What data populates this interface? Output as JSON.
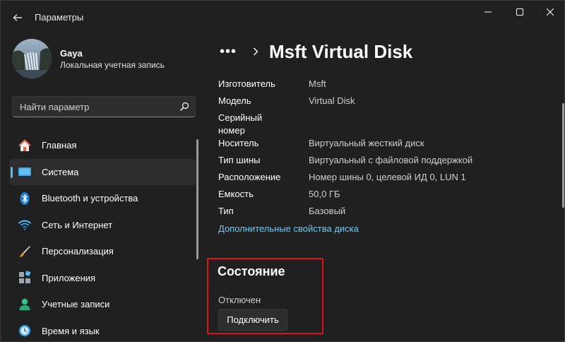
{
  "window": {
    "title": "Параметры"
  },
  "user": {
    "name": "Gaya",
    "account_type": "Локальная учетная запись"
  },
  "search": {
    "placeholder": "Найти параметр"
  },
  "sidebar": {
    "items": [
      {
        "label": "Главная",
        "icon": "home-icon"
      },
      {
        "label": "Система",
        "icon": "system-icon",
        "active": true
      },
      {
        "label": "Bluetooth и устройства",
        "icon": "bluetooth-icon"
      },
      {
        "label": "Сеть и Интернет",
        "icon": "wifi-icon"
      },
      {
        "label": "Персонализация",
        "icon": "brush-icon"
      },
      {
        "label": "Приложения",
        "icon": "apps-icon"
      },
      {
        "label": "Учетные записи",
        "icon": "accounts-icon"
      },
      {
        "label": "Время и язык",
        "icon": "time-language-icon"
      }
    ]
  },
  "breadcrumb": {
    "more": "•••",
    "title": "Msft Virtual Disk"
  },
  "properties": [
    {
      "key": "Изготовитель",
      "value": "Msft"
    },
    {
      "key": "Модель",
      "value": "Virtual Disk"
    },
    {
      "key": "Серийный номер",
      "value": ""
    },
    {
      "key": "Носитель",
      "value": "Виртуальный жесткий диск"
    },
    {
      "key": "Тип шины",
      "value": "Виртуальный с файловой поддержкой"
    },
    {
      "key": "Расположение",
      "value": "Номер шины 0, целевой ИД 0, LUN 1"
    },
    {
      "key": "Емкость",
      "value": "50,0 ГБ"
    },
    {
      "key": "Тип",
      "value": "Базовый"
    }
  ],
  "link": {
    "label": "Дополнительные свойства диска"
  },
  "status": {
    "title": "Состояние",
    "value": "Отключен",
    "button": "Подключить"
  },
  "colors": {
    "accent": "#4cc2ff",
    "link": "#60cdff",
    "highlight_box": "#e0101a",
    "background": "#202020"
  }
}
